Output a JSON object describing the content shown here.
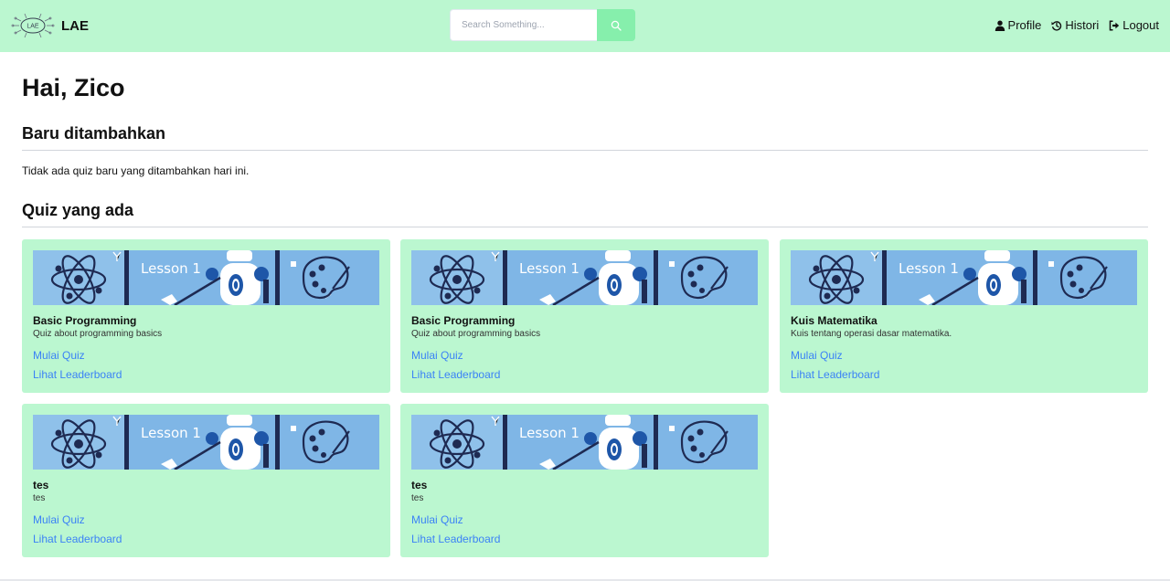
{
  "navbar": {
    "brand": "LAE",
    "logo_text": "LAE",
    "search_placeholder": "Search Something...",
    "links": [
      {
        "label": "Profile",
        "icon": "user-icon"
      },
      {
        "label": "Histori",
        "icon": "history-icon"
      },
      {
        "label": "Logout",
        "icon": "logout-icon"
      }
    ],
    "colors": {
      "navbar": "#bbf7d0",
      "search_button": "#86efac"
    }
  },
  "main": {
    "greeting": "Hai, Zico",
    "new_section_title": "Baru ditambahkan",
    "new_section_empty": "Tidak ada quiz baru yang ditambahkan hari ini.",
    "quiz_section_title": "Quiz yang ada"
  },
  "cards": [
    {
      "banner": "Lesson 1",
      "title": "Basic Programming",
      "desc": "Quiz about programming basics",
      "start": "Mulai Quiz",
      "leaderboard": "Lihat Leaderboard"
    },
    {
      "banner": "Lesson 1",
      "title": "Basic Programming",
      "desc": "Quiz about programming basics",
      "start": "Mulai Quiz",
      "leaderboard": "Lihat Leaderboard"
    },
    {
      "banner": "Lesson 1",
      "title": "Kuis Matematika",
      "desc": "Kuis tentang operasi dasar matematika.",
      "start": "Mulai Quiz",
      "leaderboard": "Lihat Leaderboard"
    },
    {
      "banner": "Lesson 1",
      "title": "tes",
      "desc": "tes",
      "start": "Mulai Quiz",
      "leaderboard": "Lihat Leaderboard"
    },
    {
      "banner": "Lesson 1",
      "title": "tes",
      "desc": "tes",
      "start": "Mulai Quiz",
      "leaderboard": "Lihat Leaderboard"
    }
  ]
}
